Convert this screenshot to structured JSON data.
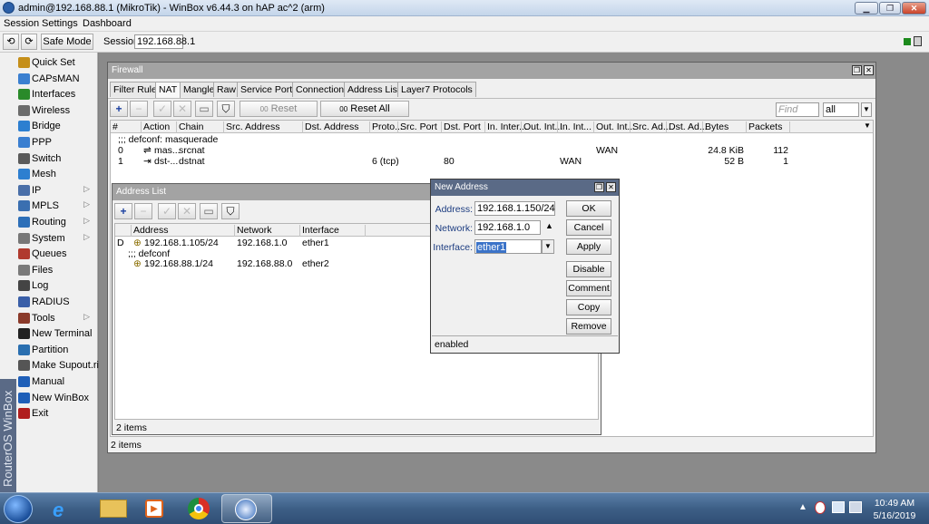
{
  "window": {
    "title": "admin@192.168.88.1 (MikroTik) - WinBox v6.44.3 on hAP ac^2 (arm)"
  },
  "menu": [
    "Session",
    "Settings",
    "Dashboard"
  ],
  "toolbar": {
    "safe_mode": "Safe Mode",
    "session_label": "Session:",
    "session_value": "192.168.88.1"
  },
  "sidebar": {
    "brand": "RouterOS WinBox",
    "items": [
      {
        "label": "Quick Set",
        "icon": "quick-set-icon",
        "sub": false
      },
      {
        "label": "CAPsMAN",
        "icon": "capsman-icon",
        "sub": false
      },
      {
        "label": "Interfaces",
        "icon": "interfaces-icon",
        "sub": false
      },
      {
        "label": "Wireless",
        "icon": "wireless-icon",
        "sub": false
      },
      {
        "label": "Bridge",
        "icon": "bridge-icon",
        "sub": false
      },
      {
        "label": "PPP",
        "icon": "ppp-icon",
        "sub": false
      },
      {
        "label": "Switch",
        "icon": "switch-icon",
        "sub": false
      },
      {
        "label": "Mesh",
        "icon": "mesh-icon",
        "sub": false
      },
      {
        "label": "IP",
        "icon": "ip-icon",
        "sub": true
      },
      {
        "label": "MPLS",
        "icon": "mpls-icon",
        "sub": true
      },
      {
        "label": "Routing",
        "icon": "routing-icon",
        "sub": true
      },
      {
        "label": "System",
        "icon": "system-icon",
        "sub": true
      },
      {
        "label": "Queues",
        "icon": "queues-icon",
        "sub": false
      },
      {
        "label": "Files",
        "icon": "files-icon",
        "sub": false
      },
      {
        "label": "Log",
        "icon": "log-icon",
        "sub": false
      },
      {
        "label": "RADIUS",
        "icon": "radius-icon",
        "sub": false
      },
      {
        "label": "Tools",
        "icon": "tools-icon",
        "sub": true
      },
      {
        "label": "New Terminal",
        "icon": "terminal-icon",
        "sub": false
      },
      {
        "label": "Partition",
        "icon": "partition-icon",
        "sub": false
      },
      {
        "label": "Make Supout.rif",
        "icon": "supout-icon",
        "sub": false
      },
      {
        "label": "Manual",
        "icon": "manual-icon",
        "sub": false
      },
      {
        "label": "New WinBox",
        "icon": "winbox-icon",
        "sub": false
      },
      {
        "label": "Exit",
        "icon": "exit-icon",
        "sub": false
      }
    ]
  },
  "firewall": {
    "title": "Firewall",
    "tabs": [
      "Filter Rules",
      "NAT",
      "Mangle",
      "Raw",
      "Service Ports",
      "Connections",
      "Address Lists",
      "Layer7 Protocols"
    ],
    "selected_tab": "NAT",
    "reset_counters": "Reset Counters",
    "reset_all_counters": "Reset All Counters",
    "find_placeholder": "Find",
    "filter_value": "all",
    "columns": [
      "#",
      "Action",
      "Chain",
      "Src. Address",
      "Dst. Address",
      "Proto...",
      "Src. Port",
      "Dst. Port",
      "In. Inter...",
      "Out. Int...",
      "In. Int...",
      "Out. Int...",
      "Src. Ad...",
      "Dst. Ad...",
      "Bytes",
      "Packets"
    ],
    "comment": ";;; defconf: masquerade",
    "rows": [
      {
        "num": "0",
        "action": "mas...",
        "chain": "srcnat",
        "proto": "",
        "dst_port": "",
        "in_int": "",
        "out_int": "WAN",
        "bytes": "24.8 KiB",
        "packets": "112"
      },
      {
        "num": "1",
        "action": "dst-...",
        "chain": "dstnat",
        "proto": "6 (tcp)",
        "dst_port": "80",
        "in_int": "WAN",
        "out_int": "",
        "bytes": "52 B",
        "packets": "1"
      }
    ],
    "footer": "2 items"
  },
  "address_list": {
    "title": "Address List",
    "columns": [
      "Address",
      "Network",
      "Interface"
    ],
    "rows": [
      {
        "flag": "D",
        "address": "192.168.1.105/24",
        "network": "192.168.1.0",
        "interface": "ether1"
      },
      {
        "flag": "",
        "address": "192.168.88.1/24",
        "network": "192.168.88.0",
        "interface": "ether2"
      }
    ],
    "comment": ";;; defconf",
    "footer": "2 items"
  },
  "new_address": {
    "title": "New Address",
    "address_label": "Address:",
    "address_value": "192.168.1.150/24",
    "network_label": "Network:",
    "network_value": "192.168.1.0",
    "interface_label": "Interface:",
    "interface_value": "ether1",
    "buttons": {
      "ok": "OK",
      "cancel": "Cancel",
      "apply": "Apply",
      "disable": "Disable",
      "comment": "Comment",
      "copy": "Copy",
      "remove": "Remove"
    },
    "status": "enabled"
  },
  "taskbar": {
    "time": "10:49 AM",
    "date": "5/16/2019"
  }
}
